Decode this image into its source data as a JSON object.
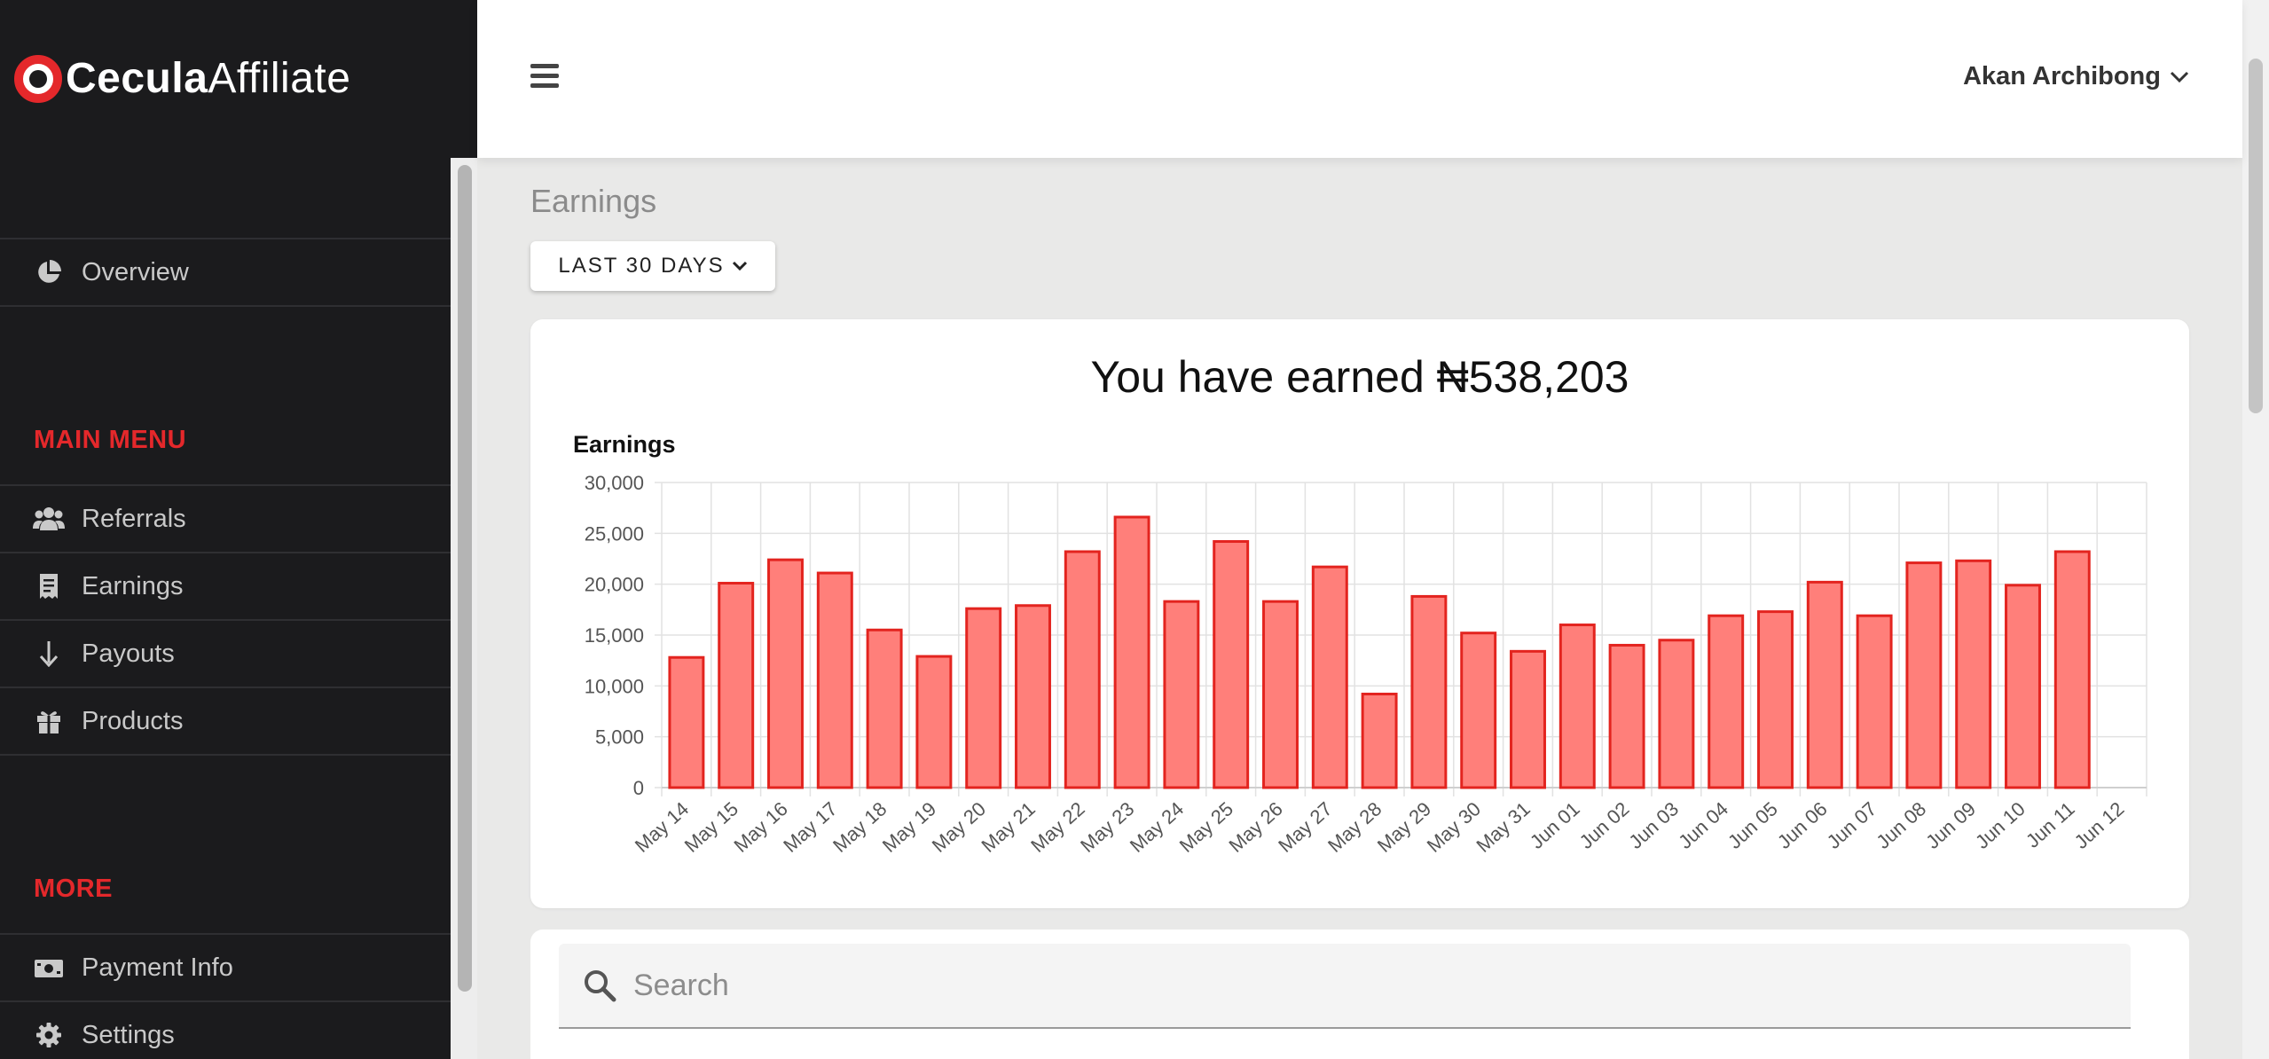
{
  "brand": {
    "name_bold": "Cecula",
    "name_light": "Affiliate"
  },
  "sidebar": {
    "overview": {
      "label": "Overview",
      "icon": "pie-chart-icon"
    },
    "main_heading": "MAIN MENU",
    "main_items": [
      {
        "label": "Referrals",
        "icon": "users-icon"
      },
      {
        "label": "Earnings",
        "icon": "receipt-icon"
      },
      {
        "label": "Payouts",
        "icon": "arrow-down-icon"
      },
      {
        "label": "Products",
        "icon": "gift-icon"
      }
    ],
    "more_heading": "MORE",
    "more_items": [
      {
        "label": "Payment Info",
        "icon": "money-icon"
      },
      {
        "label": "Settings",
        "icon": "gear-icon"
      }
    ]
  },
  "topbar": {
    "user_name": "Akan Archibong"
  },
  "page": {
    "title": "Earnings",
    "range_label": "LAST 30 DAYS"
  },
  "summary": {
    "earned_text": "You have earned ₦538,203"
  },
  "search": {
    "placeholder": "Search"
  },
  "colors": {
    "accent": "#e4282b",
    "bar_fill": "#ff7f7a",
    "bar_stroke": "#e3241f",
    "sidebar_bg": "#1b1b1d"
  },
  "chart_data": {
    "type": "bar",
    "title": "Earnings",
    "categories": [
      "May 14",
      "May 15",
      "May 16",
      "May 17",
      "May 18",
      "May 19",
      "May 20",
      "May 21",
      "May 22",
      "May 23",
      "May 24",
      "May 25",
      "May 26",
      "May 27",
      "May 28",
      "May 29",
      "May 30",
      "May 31",
      "Jun 01",
      "Jun 02",
      "Jun 03",
      "Jun 04",
      "Jun 05",
      "Jun 06",
      "Jun 07",
      "Jun 08",
      "Jun 09",
      "Jun 10",
      "Jun 11",
      "Jun 12"
    ],
    "values": [
      12800,
      20100,
      22400,
      21100,
      15500,
      12900,
      17600,
      17900,
      23200,
      26600,
      18300,
      24200,
      18300,
      21700,
      9200,
      18800,
      15200,
      13400,
      16000,
      14000,
      14500,
      16900,
      17300,
      20200,
      16900,
      22100,
      22300,
      19900,
      23200,
      0
    ],
    "ylim": [
      0,
      30000
    ],
    "yticks": [
      0,
      5000,
      10000,
      15000,
      20000,
      25000,
      30000
    ],
    "ytick_labels": [
      "0",
      "5,000",
      "10,000",
      "15,000",
      "20,000",
      "25,000",
      "30,000"
    ],
    "grid": true,
    "legend": "none"
  }
}
